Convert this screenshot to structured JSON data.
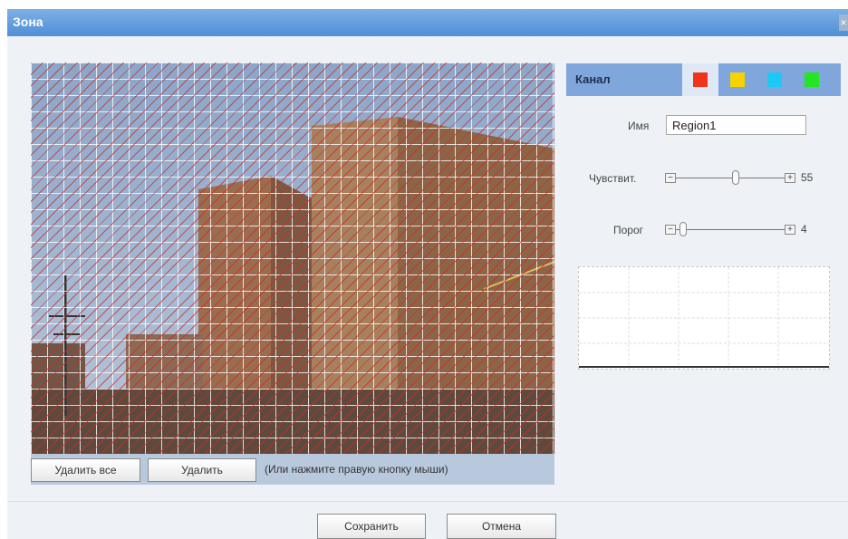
{
  "dialog": {
    "title": "Зона",
    "close_glyph": "×"
  },
  "region_actions": {
    "delete_all_label": "Удалить все",
    "delete_label": "Удалить",
    "hint": "(Или нажмите правую кнопку мыши)"
  },
  "channel": {
    "label": "Канал",
    "colors": [
      "#f0341c",
      "#f5d200",
      "#1ec8f4",
      "#25e424"
    ],
    "selected_index": 0
  },
  "name_field": {
    "label": "Имя",
    "value": "Region1"
  },
  "sensitivity": {
    "label": "Чувствит.",
    "value": "55",
    "level_percent": 55
  },
  "threshold": {
    "label": "Порог",
    "value": "4",
    "level_percent": 4
  },
  "footer": {
    "save_label": "Сохранить",
    "cancel_label": "Отмена"
  }
}
